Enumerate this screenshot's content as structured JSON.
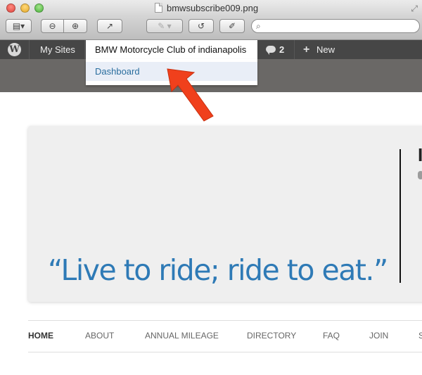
{
  "window": {
    "title": "bmwsubscribe009.png"
  },
  "toolbar": {
    "search_placeholder": ""
  },
  "adminbar": {
    "my_sites": "My Sites",
    "site_name": "BMW Motorcycle Club of indianapolis",
    "comments_count": "2",
    "new_label": "New",
    "submenu": [
      "Dashboard"
    ]
  },
  "page": {
    "tagline": "“Live to ride; ride to eat.”",
    "cut_heading_letter": "I",
    "nav": [
      "HOME",
      "ABOUT",
      "ANNUAL MILEAGE",
      "DIRECTORY",
      "FAQ",
      "JOIN",
      "S"
    ],
    "nav_active": "HOME"
  },
  "colors": {
    "adminbar_bg": "#464646",
    "link_blue": "#2e7ab6",
    "annotation_arrow": "#f0401c"
  }
}
